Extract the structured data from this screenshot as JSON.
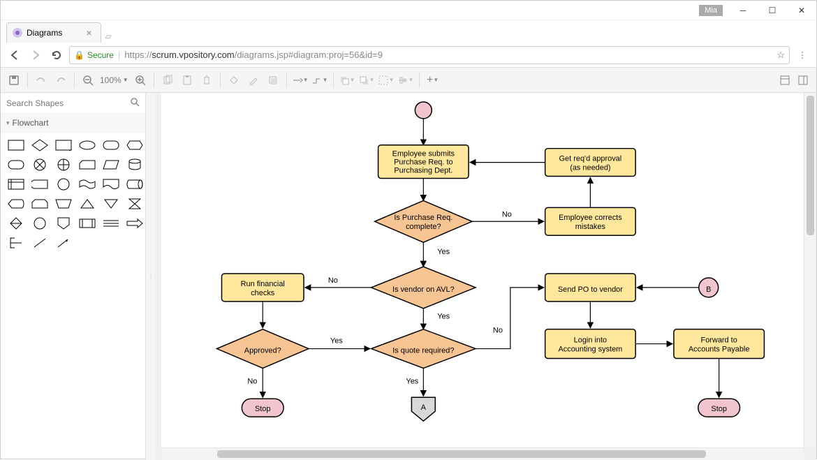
{
  "window": {
    "user": "Mia"
  },
  "tab": {
    "title": "Diagrams"
  },
  "addressbar": {
    "secure_label": "Secure",
    "url_prefix": "https://",
    "host": "scrum.vpository.com",
    "path": "/diagrams.jsp#diagram:proj=56&id=9"
  },
  "toolbar": {
    "zoom": "100%"
  },
  "sidebar": {
    "search_placeholder": "Search Shapes",
    "panel_title": "Flowchart"
  },
  "diagram": {
    "nodes": {
      "start": {
        "type": "start"
      },
      "submit": {
        "type": "process",
        "text": [
          "Employee submits",
          "Purchase Req. to",
          "Purchasing Dept."
        ]
      },
      "approval": {
        "type": "process",
        "text": [
          "Get req'd approval",
          "(as needed)"
        ]
      },
      "complete": {
        "type": "decision",
        "text": [
          "Is Purchase Req.",
          "complete?"
        ]
      },
      "corrects": {
        "type": "process",
        "text": [
          "Employee corrects",
          "mistakes"
        ]
      },
      "avl": {
        "type": "decision",
        "text": [
          "Is vendor on AVL?"
        ]
      },
      "finchecks": {
        "type": "process",
        "text": [
          "Run financial",
          "checks"
        ]
      },
      "sendpo": {
        "type": "process",
        "text": [
          "Send PO to vendor"
        ]
      },
      "connB": {
        "type": "connector",
        "text": "B"
      },
      "approved": {
        "type": "decision",
        "text": [
          "Approved?"
        ]
      },
      "quote": {
        "type": "decision",
        "text": [
          "Is quote required?"
        ]
      },
      "login": {
        "type": "process",
        "text": [
          "Login into",
          "Accounting system"
        ]
      },
      "forward": {
        "type": "process",
        "text": [
          "Forward to",
          "Accounts Payable"
        ]
      },
      "stop1": {
        "type": "terminator",
        "text": "Stop"
      },
      "offA": {
        "type": "offpage",
        "text": "A"
      },
      "stop2": {
        "type": "terminator",
        "text": "Stop"
      }
    },
    "edge_labels": {
      "complete_no": "No",
      "complete_yes": "Yes",
      "avl_no": "No",
      "avl_yes": "Yes",
      "approved_yes": "Yes",
      "approved_no": "No",
      "quote_yes": "Yes",
      "quote_no": "No"
    }
  }
}
